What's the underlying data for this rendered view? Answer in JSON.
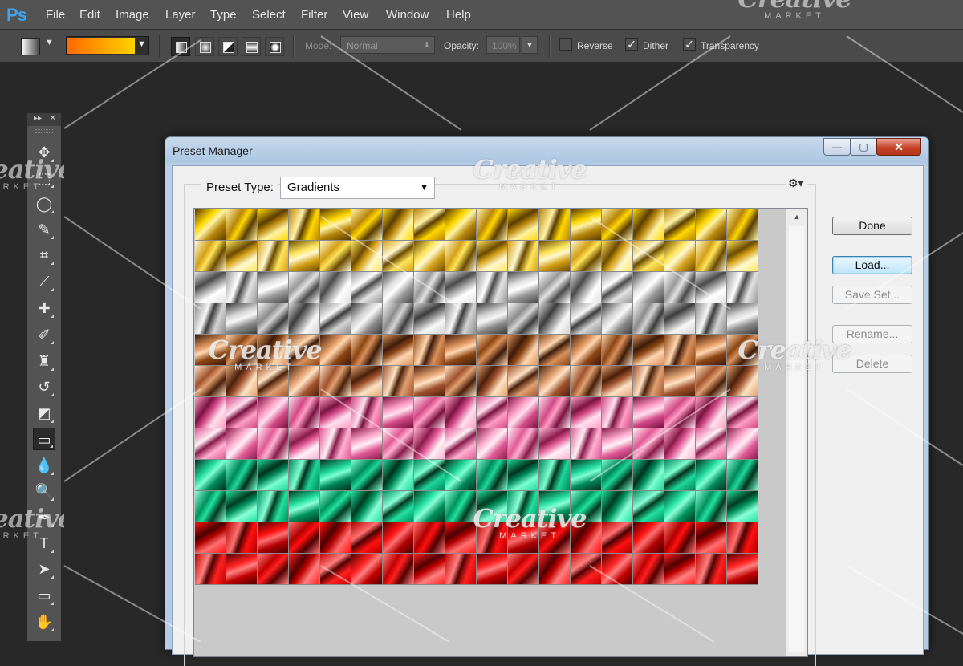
{
  "app": {
    "logo": "Ps",
    "menu": [
      "File",
      "Edit",
      "Image",
      "Layer",
      "Type",
      "Select",
      "Filter",
      "View",
      "Window",
      "Help"
    ]
  },
  "options_bar": {
    "mode_label": "Mode:",
    "mode_value": "Normal",
    "opacity_label": "Opacity:",
    "opacity_value": "100%",
    "reverse_label": "Reverse",
    "reverse_checked": false,
    "dither_label": "Dither",
    "dither_checked": true,
    "transparency_label": "Transparency",
    "transparency_checked": true,
    "gradient_colors": [
      "#ff6a00",
      "#ffd400"
    ]
  },
  "tools_panel": {
    "collapse_glyph": "▸▸",
    "close_glyph": "✕",
    "tools": [
      {
        "name": "move-tool",
        "glyph": "✥"
      },
      {
        "name": "marquee-tool",
        "glyph": "⬚"
      },
      {
        "name": "lasso-tool",
        "glyph": "◯"
      },
      {
        "name": "quick-selection-tool",
        "glyph": "✎"
      },
      {
        "name": "crop-tool",
        "glyph": "⌗"
      },
      {
        "name": "eyedropper-tool",
        "glyph": "⟋"
      },
      {
        "name": "healing-brush-tool",
        "glyph": "✚"
      },
      {
        "name": "brush-tool",
        "glyph": "✐"
      },
      {
        "name": "clone-stamp-tool",
        "glyph": "♜"
      },
      {
        "name": "history-brush-tool",
        "glyph": "↺"
      },
      {
        "name": "eraser-tool",
        "glyph": "◩"
      },
      {
        "name": "gradient-tool",
        "glyph": "▭"
      },
      {
        "name": "blur-tool",
        "glyph": "💧"
      },
      {
        "name": "dodge-tool",
        "glyph": "🔍"
      },
      {
        "name": "pen-tool",
        "glyph": "✒"
      },
      {
        "name": "type-tool",
        "glyph": "T"
      },
      {
        "name": "path-selection-tool",
        "glyph": "➤"
      },
      {
        "name": "rectangle-tool",
        "glyph": "▭"
      },
      {
        "name": "hand-tool",
        "glyph": "✋"
      }
    ],
    "selected_tool": "gradient-tool"
  },
  "dialog": {
    "title": "Preset Manager",
    "minimize_glyph": "—",
    "maximize_glyph": "▢",
    "close_glyph": "✕",
    "preset_type_label": "Preset Type:",
    "preset_type_value": "Gradients",
    "gear_glyph": "⚙▾",
    "buttons": {
      "done": "Done",
      "load": "Load...",
      "save_set": "Save Set...",
      "rename": "Rename...",
      "delete": "Delete"
    },
    "swatch_rows": [
      {
        "family": "gold",
        "colors": [
          "#5a3c00",
          "#b8860b",
          "#ffd700",
          "#fff3a6"
        ]
      },
      {
        "family": "gold",
        "colors": [
          "#6b4a00",
          "#d4a017",
          "#ffe55c",
          "#fff9d1"
        ]
      },
      {
        "family": "silver",
        "colors": [
          "#4a4a4a",
          "#9a9a9a",
          "#e2e2e2",
          "#ffffff"
        ]
      },
      {
        "family": "silver",
        "colors": [
          "#3c3c3c",
          "#8c8c8c",
          "#d4d4d4",
          "#f7f7f7"
        ]
      },
      {
        "family": "copper",
        "colors": [
          "#3d1a08",
          "#8b4513",
          "#d9905a",
          "#ffd6b0"
        ]
      },
      {
        "family": "copper",
        "colors": [
          "#4a1f0a",
          "#a0522d",
          "#e0a070",
          "#ffe3c4"
        ]
      },
      {
        "family": "pink",
        "colors": [
          "#7a1240",
          "#d24a86",
          "#ff9ec4",
          "#ffe0ee"
        ]
      },
      {
        "family": "pink",
        "colors": [
          "#8a1a4a",
          "#e05a95",
          "#ffb0d0",
          "#fff0f6"
        ]
      },
      {
        "family": "green",
        "colors": [
          "#00301c",
          "#00875a",
          "#1fd69a",
          "#7dffd2"
        ]
      },
      {
        "family": "green",
        "colors": [
          "#003a20",
          "#00915e",
          "#22e0a0",
          "#8affd8"
        ]
      },
      {
        "family": "red",
        "colors": [
          "#4a0000",
          "#b00000",
          "#ff1010",
          "#ff7070"
        ]
      },
      {
        "family": "red",
        "colors": [
          "#500000",
          "#c00000",
          "#ff2020",
          "#ff8080"
        ]
      }
    ]
  },
  "watermark": {
    "brand": "Creative",
    "sub": "MARKET"
  }
}
